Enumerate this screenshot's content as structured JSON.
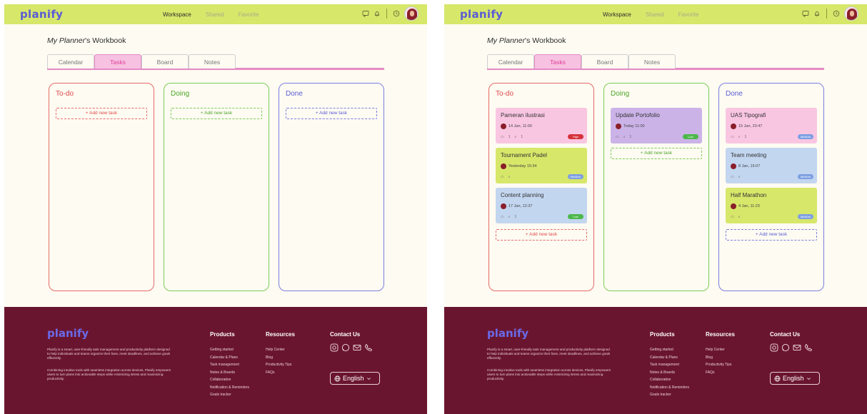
{
  "app": {
    "brand": "planify",
    "nav": [
      "Workspace",
      "Shared",
      "Favorite"
    ],
    "workbook_title_prefix": "My Planner",
    "workbook_title_suffix": "'s Workbook"
  },
  "tabs": [
    "Calendar",
    "Tasks",
    "Board",
    "Notes"
  ],
  "columns": {
    "todo": "To-do",
    "doing": "Doing",
    "done": "Done"
  },
  "add_task_label": "+ Add new task",
  "cards": {
    "todo": [
      {
        "title": "Pameran ilustrasi",
        "date": "14 Jan, 11:00",
        "comments": "1",
        "attachments": "1",
        "priority": "High"
      },
      {
        "title": "Tournament Padel",
        "date": "Yesterday 15:34",
        "comments": "",
        "attachments": "",
        "priority": "Medium"
      },
      {
        "title": "Content planning",
        "date": "17 Jan, 12:37",
        "comments": "",
        "attachments": "1",
        "priority": "Low"
      }
    ],
    "doing": [
      {
        "title": "Update Portofolio",
        "date": "Today 11:00",
        "comments": "",
        "attachments": "1",
        "priority": "Low"
      }
    ],
    "done": [
      {
        "title": "UAS Tipografi",
        "date": "15 Jan, 23:47",
        "comments": "",
        "attachments": "1",
        "priority": "Medium"
      },
      {
        "title": "Team meeting",
        "date": "8 Jan, 16:07",
        "comments": "",
        "attachments": "",
        "priority": "Medium"
      },
      {
        "title": "Half Marathon",
        "date": "4 Jan, 11:23",
        "comments": "",
        "attachments": "",
        "priority": "Medium"
      }
    ]
  },
  "footer": {
    "brand": "planify",
    "desc1": "Planify is a smart, user-friendly task management and productivity platform designed to help individuals and teams organize their lives, meet deadlines, and achieve goals efficiently.",
    "desc2": "Combining intuitive tools with seamless integration across devices, Planify empowers users to turn plans into actionable steps while minimizing stress and maximizing productivity.",
    "products_title": "Products",
    "products": [
      "Getting started",
      "Calendar & Plans",
      "Task management",
      "Notes & Boards",
      "Collaboration",
      "Notification & Reminders",
      "Goals tracker"
    ],
    "resources_title": "Resources",
    "resources": [
      "Help Center",
      "Blog",
      "Productivity Tips",
      "FAQs"
    ],
    "contact_title": "Contact Us",
    "language": "English"
  },
  "colors": {
    "topbar": "#d7e76a",
    "brand": "#5b5bd6",
    "footer": "#6a1530",
    "todo": "#e86a6a",
    "doing": "#7ccc55",
    "done": "#7d7de0",
    "tab_active": "#f7c1e1"
  }
}
